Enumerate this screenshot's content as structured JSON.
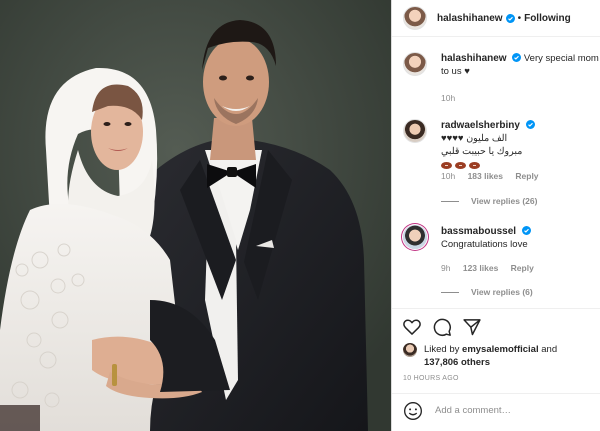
{
  "header": {
    "username": "halashihanew",
    "separator": "•",
    "follow_status": "Following"
  },
  "caption": {
    "username": "halashihanew",
    "text": "Very special mom",
    "text_line2": "to us ♥",
    "time": "10h"
  },
  "comments": [
    {
      "username": "radwaelsherbiny",
      "text_line1": "الف مليون ♥♥♥♥",
      "text_line2": "مبروك يا حبيبت قلبي",
      "time": "10h",
      "likes": "183 likes",
      "reply_label": "Reply",
      "view_replies": "View replies (26)"
    },
    {
      "username": "bassmaboussel",
      "text": "Congratulations love",
      "time": "9h",
      "likes": "123 likes",
      "reply_label": "Reply",
      "view_replies": "View replies (6)"
    }
  ],
  "actions": {
    "liked_prefix": "Liked by",
    "liked_user": "emysalemofficial",
    "liked_and": "and",
    "liked_count": "137,806 others",
    "time_ago": "10 HOURS AGO",
    "add_comment_placeholder": "Add a comment…"
  },
  "icons": {
    "verified": "verified-badge-icon",
    "like": "heart-icon",
    "comment": "comment-bubble-icon",
    "share": "paper-plane-icon",
    "emoji": "smiley-icon"
  },
  "colors": {
    "verified_blue": "#0095f6",
    "muted": "#8e8e8e",
    "text": "#262626",
    "heart_red": "#ed4956"
  }
}
